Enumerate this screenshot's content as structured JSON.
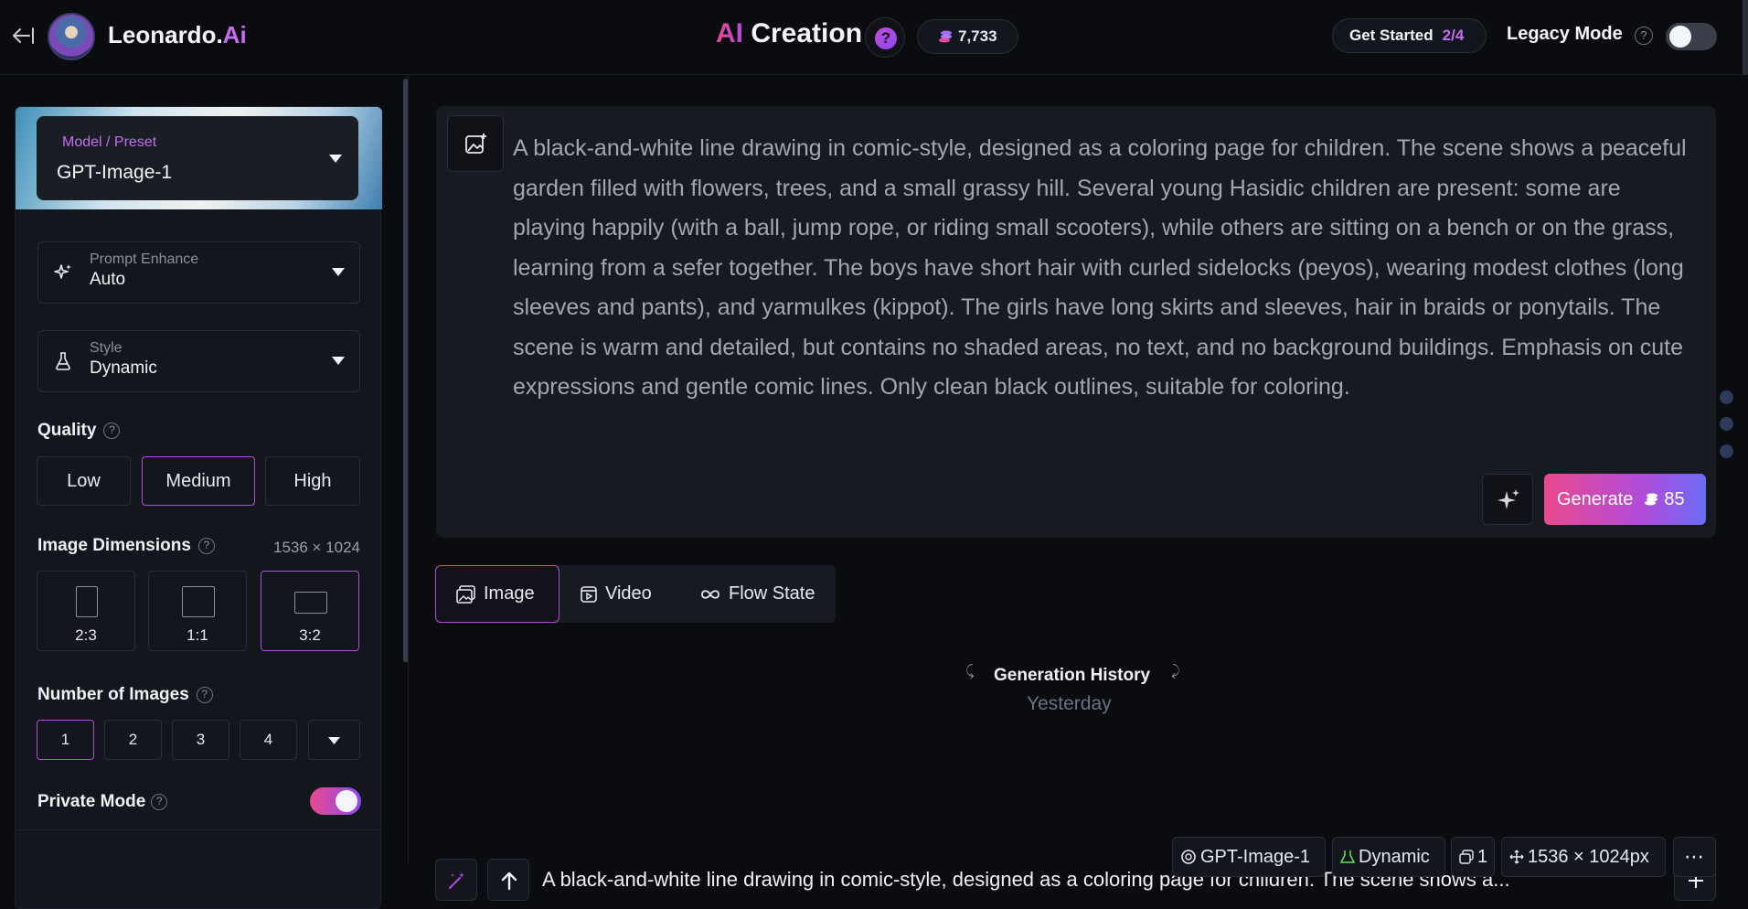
{
  "header": {
    "back_icon": "arrow-left-to-line-icon",
    "logo_name": "Leonardo.",
    "logo_suffix": "Ai",
    "title_ai": "AI",
    "title_rest": "Creation",
    "help_label": "?",
    "credits": "7,733",
    "get_started_label": "Get Started",
    "get_started_progress": "2/4",
    "legacy_mode_label": "Legacy Mode",
    "legacy_mode_on": false
  },
  "sidebar": {
    "model_label": "Model / Preset",
    "model_value": "GPT-Image-1",
    "prompt_enhance_label": "Prompt Enhance",
    "prompt_enhance_value": "Auto",
    "style_label": "Style",
    "style_value": "Dynamic",
    "quality_label": "Quality",
    "quality_options": [
      "Low",
      "Medium",
      "High"
    ],
    "quality_selected": "Medium",
    "dimensions_label": "Image Dimensions",
    "dimensions_value": "1536 × 1024",
    "dimension_options": [
      "2:3",
      "1:1",
      "3:2"
    ],
    "dimension_selected": "3:2",
    "num_images_label": "Number of Images",
    "num_images_options": [
      "1",
      "2",
      "3",
      "4"
    ],
    "num_images_selected": "1",
    "private_mode_label": "Private Mode",
    "private_mode_on": true
  },
  "prompt": {
    "text": "A black-and-white line drawing in comic-style, designed as a coloring page for children. The scene shows a peaceful garden filled with flowers, trees, and a small grassy hill. Several young Hasidic children are present: some are playing happily (with a ball, jump rope, or riding small scooters), while others are sitting on a bench or on the grass, learning from a sefer together. The boys have short hair with curled sidelocks (peyos), wearing modest clothes (long sleeves and pants), and yarmulkes (kippot). The girls have long skirts and sleeves, hair in braids or ponytails. The scene is warm and detailed, but contains no shaded areas, no text, and no background buildings. Emphasis on cute expressions and gentle comic lines. Only clean black outlines, suitable for coloring.",
    "generate_label": "Generate",
    "generate_cost": "85"
  },
  "tabs": [
    {
      "label": "Image",
      "icon": "image-icon"
    },
    {
      "label": "Video",
      "icon": "video-icon"
    },
    {
      "label": "Flow State",
      "icon": "infinity-icon"
    }
  ],
  "history": {
    "title": "Generation History",
    "date": "Yesterday",
    "item_prompt": "A black-and-white line drawing in comic-style, designed as a coloring page for children. The scene shows a...",
    "chip_model": "GPT-Image-1",
    "chip_style": "Dynamic",
    "chip_count": "1",
    "chip_size": "1536 × 1024px"
  },
  "colors": {
    "accent_pink": "#e94a8f",
    "accent_purple": "#b24bd9",
    "accent_blue": "#6b6cf6",
    "background": "#0b0c10",
    "panel": "#14161d"
  }
}
